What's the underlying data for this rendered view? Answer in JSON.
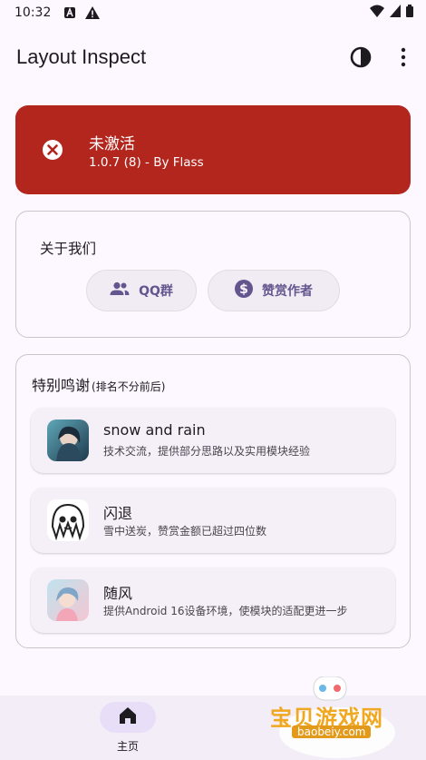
{
  "status_bar": {
    "time": "10:32"
  },
  "app_bar": {
    "title": "Layout Inspect"
  },
  "status_card": {
    "title": "未激活",
    "subtitle": "1.0.7 (8) - By Flass",
    "color": "#b3261e"
  },
  "about": {
    "title": "关于我们",
    "buttons": [
      {
        "label": "QQ群",
        "icon": "group-icon"
      },
      {
        "label": "赞赏作者",
        "icon": "dollar-icon"
      }
    ]
  },
  "thanks": {
    "title": "特别鸣谢",
    "note": "(排名不分前后)",
    "items": [
      {
        "name": "snow and rain",
        "desc": "技术交流，提供部分思路以及实用模块经验"
      },
      {
        "name": "闪退",
        "desc": "雪中送炭，赞赏金额已超过四位数"
      },
      {
        "name": "随风",
        "desc": "提供Android 16设备环境，使模块的适配更进一步"
      }
    ]
  },
  "nav": {
    "items": [
      {
        "label": "主页",
        "icon": "home-icon"
      }
    ]
  },
  "watermark": {
    "text": "宝贝游戏网",
    "url": "baobeiy.com"
  },
  "colors": {
    "accent": "#65558f",
    "background": "#fdf7ff",
    "nav_indicator": "#e8def8"
  }
}
